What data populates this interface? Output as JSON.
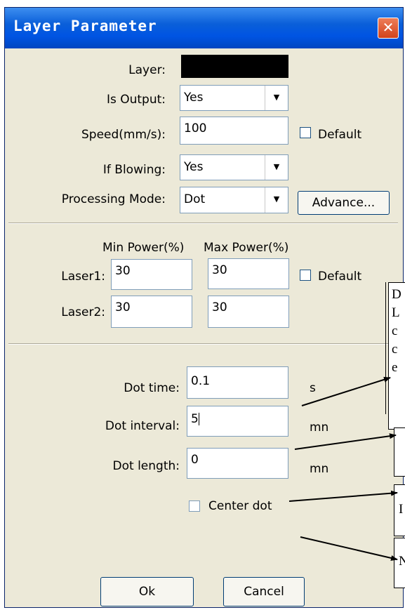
{
  "dialog": {
    "title": "Layer Parameter",
    "close_glyph": "✕"
  },
  "fields": {
    "layer_label": "Layer:",
    "layer_color": "#000000",
    "is_output_label": "Is Output:",
    "is_output_value": "Yes",
    "speed_label": "Speed(mm/s):",
    "speed_value": "100",
    "speed_default_label": "Default",
    "if_blowing_label": "If Blowing:",
    "if_blowing_value": "Yes",
    "processing_mode_label": "Processing Mode:",
    "processing_mode_value": "Dot",
    "advance_label": "Advance..."
  },
  "power": {
    "min_header": "Min Power(%)",
    "max_header": "Max Power(%)",
    "laser1_label": "Laser1:",
    "laser1_min": "30",
    "laser1_max": "30",
    "laser2_label": "Laser2:",
    "laser2_min": "30",
    "laser2_max": "30",
    "default_label": "Default"
  },
  "dot": {
    "time_label": "Dot time:",
    "time_value": "0.1",
    "time_unit": "s",
    "interval_label": "Dot interval:",
    "interval_value": "5",
    "interval_unit": "mn",
    "length_label": "Dot length:",
    "length_value": "0",
    "length_unit": "mn",
    "center_label": "Center dot"
  },
  "buttons": {
    "ok": "Ok",
    "cancel": "Cancel"
  },
  "annotations": {
    "box1_lines": [
      "D",
      "L",
      "c",
      "c",
      "e"
    ],
    "box4_text": "I",
    "box5_text": "N"
  },
  "icons": {
    "dropdown": "chevron-down-icon",
    "close": "close-icon"
  }
}
